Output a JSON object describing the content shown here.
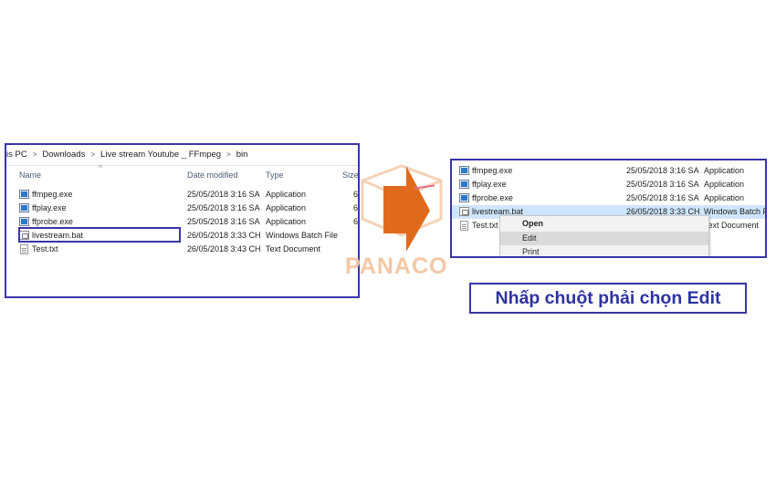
{
  "left": {
    "breadcrumb": [
      "is PC",
      "Downloads",
      "Live stream Youtube _ FFmpeg",
      "bin"
    ],
    "columns": {
      "name": "Name",
      "date": "Date modified",
      "type": "Type",
      "size": "Size"
    },
    "files": [
      {
        "name": "ffmpeg.exe",
        "date": "25/05/2018 3:16 SA",
        "type": "Application",
        "icon": "app",
        "size": "6"
      },
      {
        "name": "ffplay.exe",
        "date": "25/05/2018 3:16 SA",
        "type": "Application",
        "icon": "app",
        "size": "6"
      },
      {
        "name": "ffprobe.exe",
        "date": "25/05/2018 3:16 SA",
        "type": "Application",
        "icon": "app",
        "size": "6"
      },
      {
        "name": "livestream.bat",
        "date": "26/05/2018 3:33 CH",
        "type": "Windows Batch File",
        "icon": "bat",
        "size": ""
      },
      {
        "name": "Test.txt",
        "date": "26/05/2018 3:43 CH",
        "type": "Text Document",
        "icon": "txt",
        "size": ""
      }
    ]
  },
  "right": {
    "files": [
      {
        "name": "ffmpeg.exe",
        "date": "25/05/2018 3:16 SA",
        "type": "Application",
        "icon": "app"
      },
      {
        "name": "ffplay.exe",
        "date": "25/05/2018 3:16 SA",
        "type": "Application",
        "icon": "app"
      },
      {
        "name": "ffprobe.exe",
        "date": "25/05/2018 3:16 SA",
        "type": "Application",
        "icon": "app"
      },
      {
        "name": "livestream.bat",
        "date": "26/05/2018 3:33 CH",
        "type": "Windows Batch Fi",
        "icon": "bat"
      },
      {
        "name": "Test.txt",
        "date": "",
        "type": "Text Document",
        "icon": "txt"
      }
    ],
    "context_menu": {
      "open": "Open",
      "edit": "Edit",
      "print": "Print"
    }
  },
  "watermark": "PANACO",
  "caption": "Nhấp chuột phải chọn Edit",
  "colors": {
    "frame": "#3a35a8",
    "arrow": "#e06a1b",
    "selection": "#cde6fb",
    "caption_text": "#2e33a0"
  }
}
